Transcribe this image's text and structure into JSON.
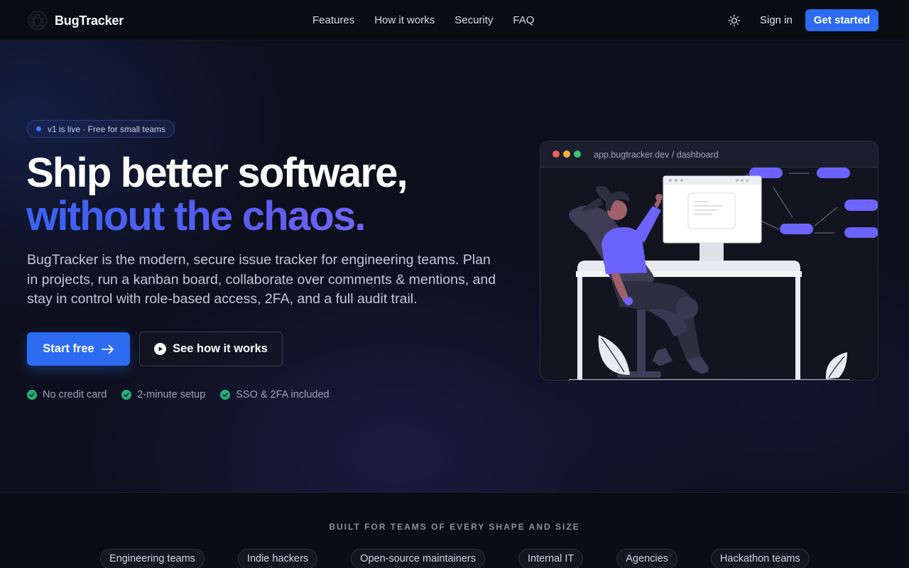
{
  "nav": {
    "brand": "BugTracker",
    "links": [
      "Features",
      "How it works",
      "Security",
      "FAQ"
    ],
    "sign_in": "Sign in",
    "cta": "Get started"
  },
  "hero": {
    "badge": "v1 is live · Free for small teams",
    "headline_line1": "Ship better software,",
    "headline_line2": "without the chaos.",
    "lead": "BugTracker is the modern, secure issue tracker for engineering teams. Plan in projects, run a kanban board, collaborate over comments & mentions, and stay in control with role-based access, 2FA, and a full audit trail.",
    "primary_button": "Start free",
    "secondary_button": "See how it works",
    "perks": [
      "No credit card",
      "2-minute setup",
      "SSO & 2FA included"
    ]
  },
  "mockup": {
    "url": "app.bugtracker.dev / dashboard",
    "window_dots": [
      "#f0605a",
      "#f5b33a",
      "#3ec67a"
    ]
  },
  "teams": {
    "heading": "BUILT FOR TEAMS OF EVERY SHAPE AND SIZE",
    "chips": [
      "Engineering teams",
      "Indie hackers",
      "Open-source maintainers",
      "Internal IT",
      "Agencies",
      "Hackathon teams"
    ]
  },
  "colors": {
    "accent": "#2d6cf0",
    "gradient_text": "#5d5cf0",
    "success": "#22b07d",
    "illustration_accent": "#6c63ff"
  },
  "icons": [
    "logo-mark-icon",
    "sun-icon",
    "arrow-right-icon",
    "play-circle-icon",
    "check-circle-icon"
  ]
}
